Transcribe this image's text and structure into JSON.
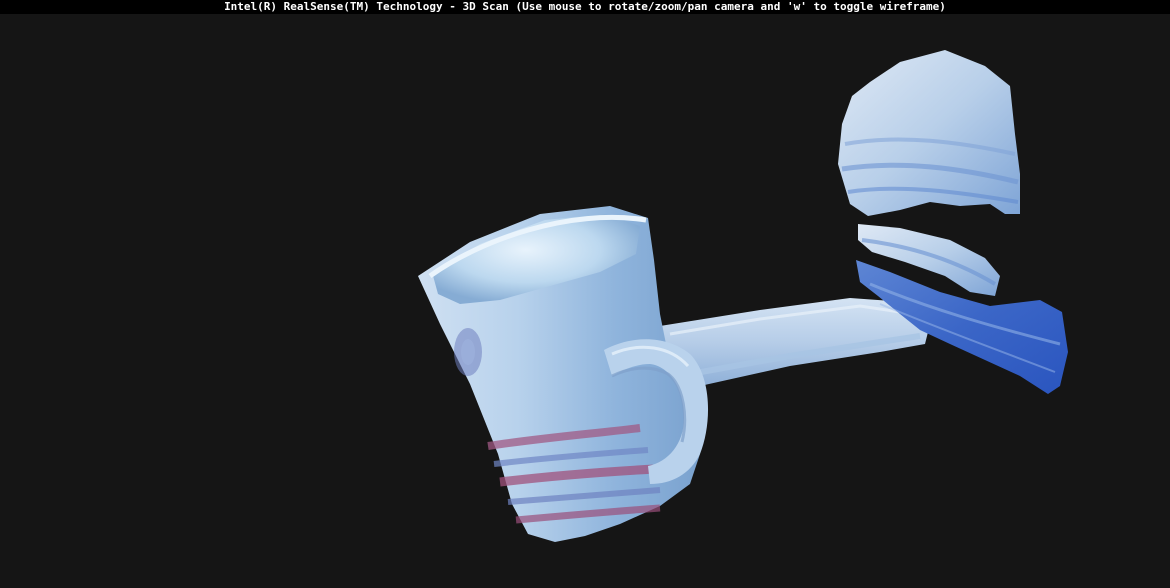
{
  "window": {
    "title": "Intel(R) RealSense(TM) Technology - 3D Scan (Use mouse to rotate/zoom/pan camera and 'w' to toggle wireframe)"
  },
  "viewport": {
    "background": "#151515",
    "wireframe": false
  },
  "scene": {
    "objects": [
      {
        "name": "scanned-mug-mesh",
        "color": "#a9c8e6"
      },
      {
        "name": "table-surface-strip-mesh",
        "color": "#bcd2ea"
      },
      {
        "name": "background-fragment-mesh",
        "color": "#c4d6ec"
      }
    ]
  }
}
